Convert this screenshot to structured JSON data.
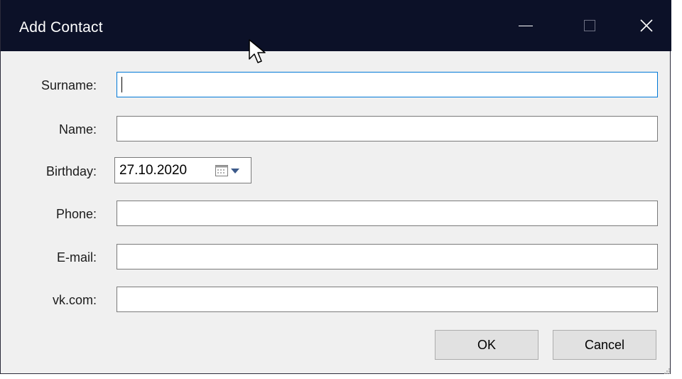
{
  "window": {
    "title": "Add Contact"
  },
  "form": {
    "surname": {
      "label": "Surname:",
      "value": ""
    },
    "name": {
      "label": "Name:",
      "value": ""
    },
    "birthday": {
      "label": "Birthday:",
      "value": "27.10.2020"
    },
    "phone": {
      "label": "Phone:",
      "value": ""
    },
    "email": {
      "label": "E-mail:",
      "value": ""
    },
    "vk": {
      "label": "vk.com:",
      "value": ""
    }
  },
  "buttons": {
    "ok": "OK",
    "cancel": "Cancel"
  },
  "icons": {
    "minimize": "minimize-icon",
    "maximize": "maximize-icon",
    "close": "close-icon",
    "calendar": "calendar-icon",
    "dropdown": "chevron-down-icon",
    "cursor": "mouse-pointer-icon"
  },
  "colors": {
    "titlebar": "#0c1128",
    "window_bg": "#f0f0f0",
    "focus_border": "#0078d7",
    "button_bg": "#e1e1e1"
  }
}
